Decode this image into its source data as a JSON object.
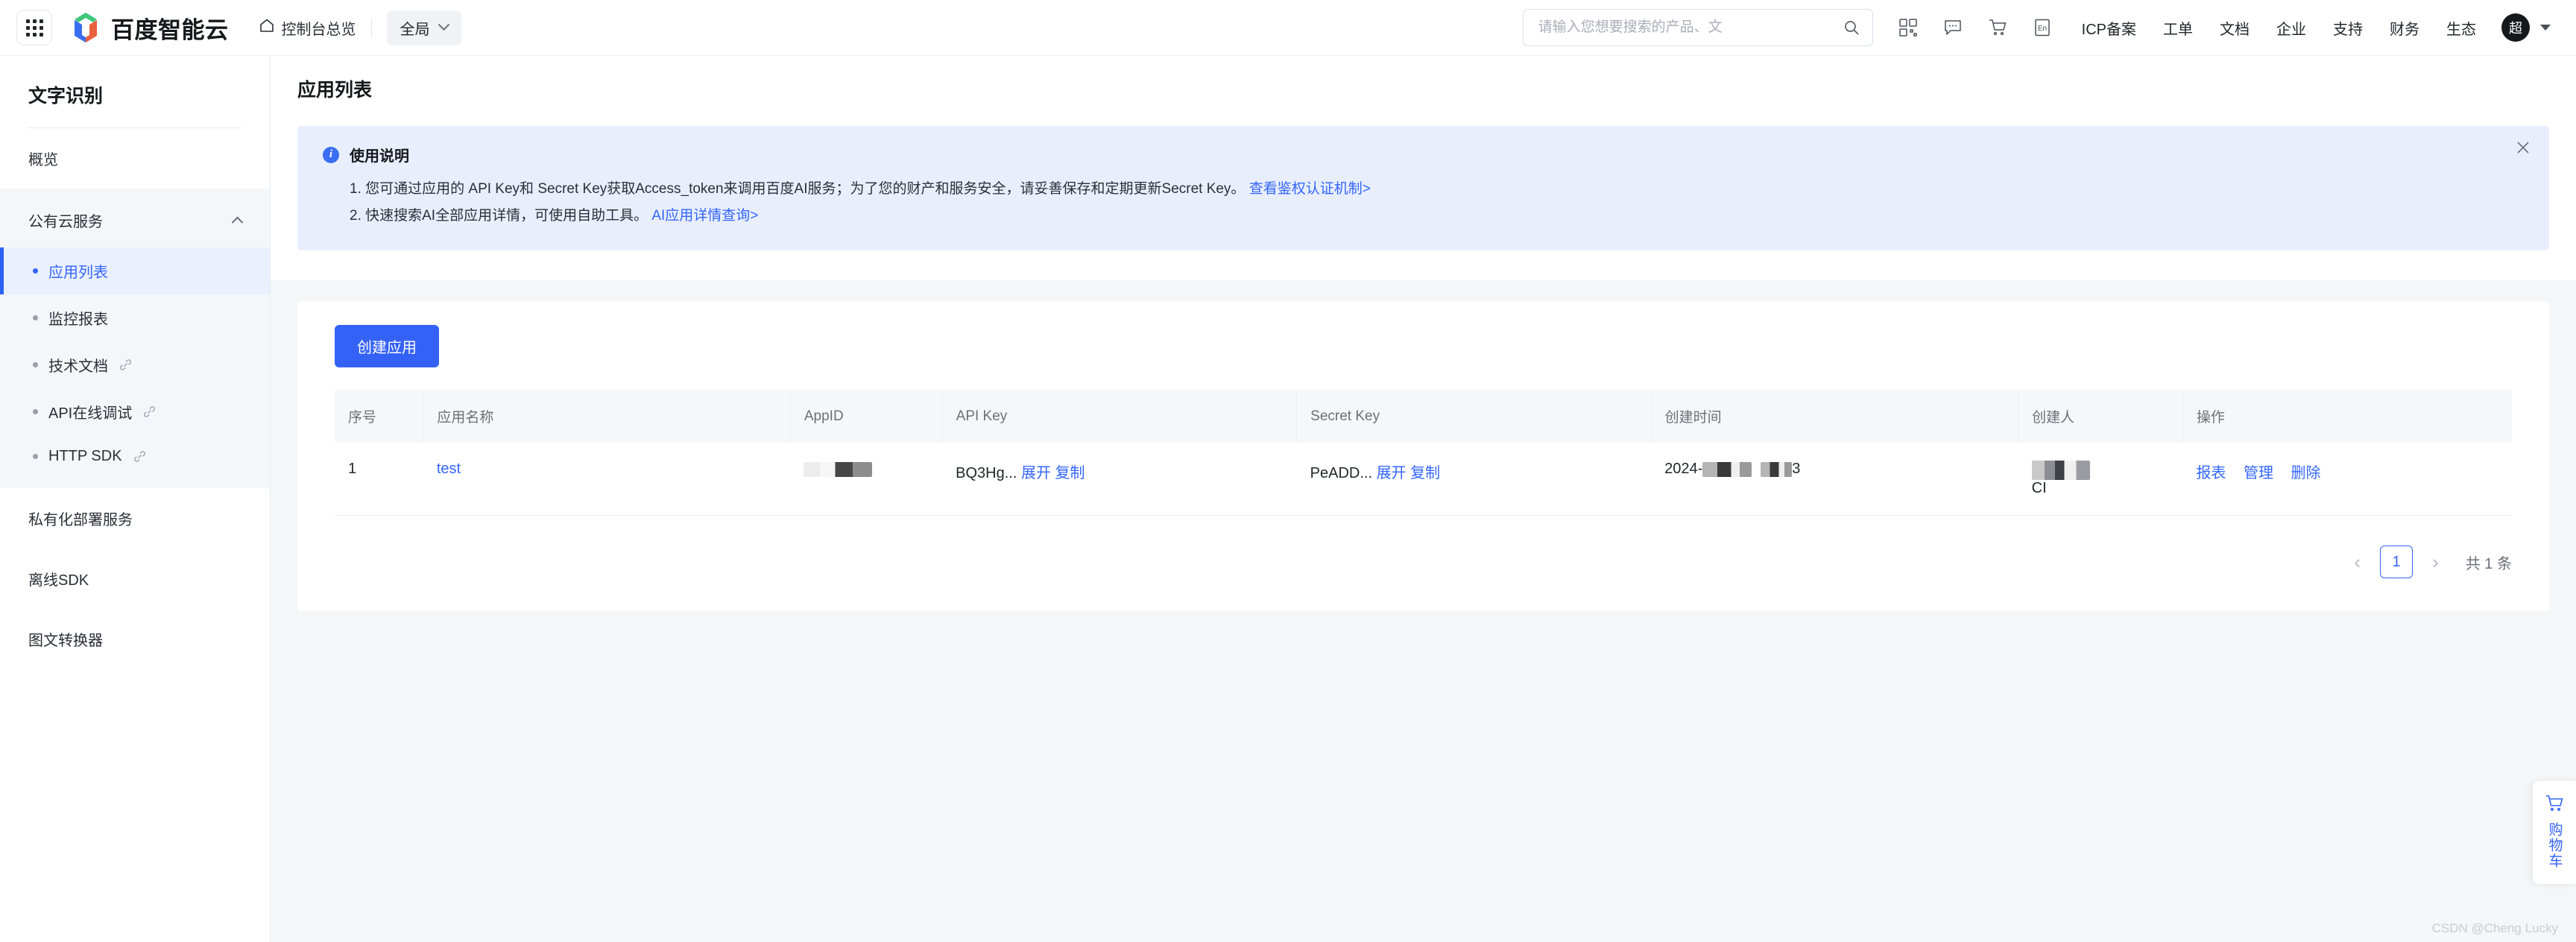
{
  "header": {
    "grid_icon": "apps-grid-icon",
    "brand": "百度智能云",
    "console_label": "控制台总览",
    "console_icon": "home-icon",
    "region": "全局",
    "region_chevron": "chevron-down-icon",
    "search": {
      "placeholder": "请输入您想要搜索的产品、文",
      "value": "",
      "icon": "search-icon"
    },
    "icons": [
      {
        "name": "qrcode-icon"
      },
      {
        "name": "message-icon"
      },
      {
        "name": "cart-icon"
      },
      {
        "name": "language-en-icon"
      }
    ],
    "nav": [
      {
        "label": "ICP备案"
      },
      {
        "label": "工单"
      },
      {
        "label": "文档"
      },
      {
        "label": "企业"
      },
      {
        "label": "支持"
      },
      {
        "label": "财务"
      },
      {
        "label": "生态"
      }
    ],
    "avatar_text": "超",
    "avatar_caret": "caret-down-icon"
  },
  "sidebar": {
    "title": "文字识别",
    "overview": "概览",
    "group": {
      "label": "公有云服务",
      "collapse_icon": "chevron-up-icon",
      "items": [
        {
          "label": "应用列表",
          "active": true,
          "external": false
        },
        {
          "label": "监控报表",
          "active": false,
          "external": false
        },
        {
          "label": "技术文档",
          "active": false,
          "external": true
        },
        {
          "label": "API在线调试",
          "active": false,
          "external": true
        },
        {
          "label": "HTTP SDK",
          "active": false,
          "external": true
        }
      ]
    },
    "bottom_items": [
      {
        "label": "私有化部署服务"
      },
      {
        "label": "离线SDK"
      },
      {
        "label": "图文转换器"
      }
    ]
  },
  "page": {
    "title": "应用列表"
  },
  "notice": {
    "icon": "info-circle-icon",
    "title": "使用说明",
    "line1_text": "1. 您可通过应用的 API Key和 Secret Key获取Access_token来调用百度AI服务；为了您的财产和服务安全，请妥善保存和定期更新Secret Key。",
    "line1_link": "查看鉴权认证机制>",
    "line2_text": "2. 快速搜索AI全部应用详情，可使用自助工具。",
    "line2_link": "AI应用详情查询>",
    "close_icon": "close-icon"
  },
  "toolbar": {
    "create_label": "创建应用"
  },
  "table": {
    "columns": [
      "序号",
      "应用名称",
      "AppID",
      "API Key",
      "Secret Key",
      "创建时间",
      "创建人",
      "操作"
    ],
    "rows": [
      {
        "index": "1",
        "app_name": "test",
        "app_id": "",
        "api_key": "BQ3Hg...",
        "api_key_expand": "展开",
        "api_key_copy": "复制",
        "secret_key": "PeADD...",
        "secret_key_expand": "展开",
        "secret_key_copy": "复制",
        "created_at_prefix": "2024-",
        "created_at_suffix": "3",
        "creator_suffix": "CI",
        "actions": [
          "报表",
          "管理",
          "删除"
        ]
      }
    ]
  },
  "pagination": {
    "prev_icon": "chevron-left-icon",
    "next_icon": "chevron-right-icon",
    "current_page": "1",
    "total_text": "共 1 条"
  },
  "cart_widget": {
    "icon": "cart-icon",
    "label": "购物车"
  },
  "watermark": "CSDN @Cheng Lucky",
  "colors": {
    "primary": "#3562f6",
    "link": "#3366ff",
    "notice_bg": "#e8eefc",
    "active_bg": "#eaf0fe"
  }
}
